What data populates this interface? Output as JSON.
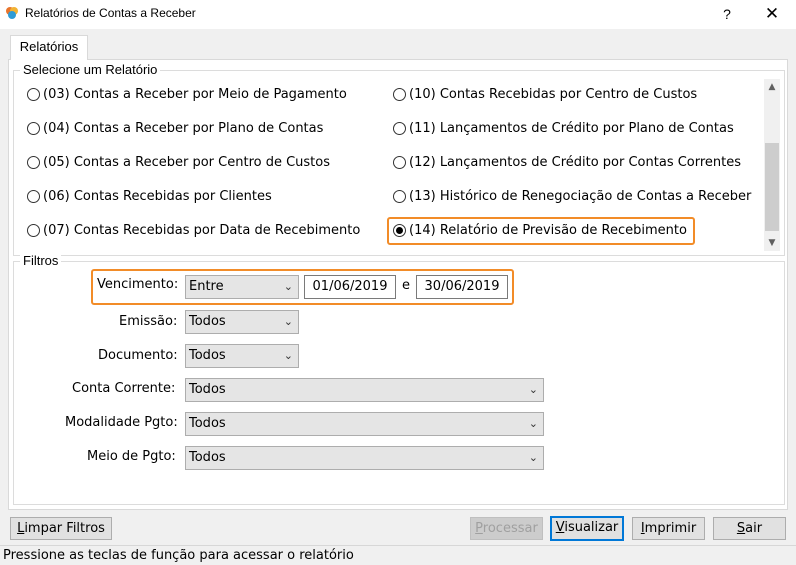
{
  "window": {
    "title": "Relatórios de Contas a Receber",
    "help": "?",
    "close": "✕"
  },
  "tab": {
    "label": "Relatórios"
  },
  "report_group": {
    "legend": "Selecione um Relatório",
    "left_items": [
      {
        "label": "(03) Contas a Receber por Meio de Pagamento",
        "checked": false
      },
      {
        "label": "(04) Contas a Receber por Plano de Contas",
        "checked": false
      },
      {
        "label": "(05) Contas a Receber por Centro de Custos",
        "checked": false
      },
      {
        "label": "(06) Contas Recebidas por Clientes",
        "checked": false
      },
      {
        "label": "(07) Contas Recebidas por Data de Recebimento",
        "checked": false
      }
    ],
    "right_items": [
      {
        "label": "(10) Contas Recebidas por Centro de Custos",
        "checked": false
      },
      {
        "label": "(11) Lançamentos de Crédito por Plano de Contas",
        "checked": false
      },
      {
        "label": "(12) Lançamentos de Crédito por Contas Correntes",
        "checked": false
      },
      {
        "label": "(13) Histórico de Renegociação de Contas a Receber",
        "checked": false
      },
      {
        "label": "(14) Relatório de Previsão de Recebimento",
        "checked": true
      }
    ]
  },
  "filters": {
    "legend": "Filtros",
    "vencimento": {
      "label": "Vencimento:",
      "mode": "Entre",
      "from": "01/06/2019",
      "and": "e",
      "to": "30/06/2019"
    },
    "emissao": {
      "label": "Emissão:",
      "value": "Todos"
    },
    "documento": {
      "label": "Documento:",
      "value": "Todos"
    },
    "conta_corrente": {
      "label": "Conta Corrente:",
      "value": "Todos"
    },
    "modalidade": {
      "label": "Modalidade Pgto:",
      "value": "Todos"
    },
    "meio": {
      "label": "Meio de Pgto:",
      "value": "Todos"
    }
  },
  "buttons": {
    "limpar": {
      "key": "L",
      "rest": "impar Filtros"
    },
    "processar": {
      "key": "P",
      "rest": "rocessar"
    },
    "visualizar": {
      "key": "V",
      "rest": "isualizar"
    },
    "imprimir": {
      "key": "I",
      "rest": "mprimir"
    },
    "sair": {
      "key": "S",
      "rest": "air"
    }
  },
  "status": "Pressione as teclas de função para acessar o relatório",
  "colors": {
    "highlight": "#f28c28",
    "default_button_border": "#0078d7"
  }
}
